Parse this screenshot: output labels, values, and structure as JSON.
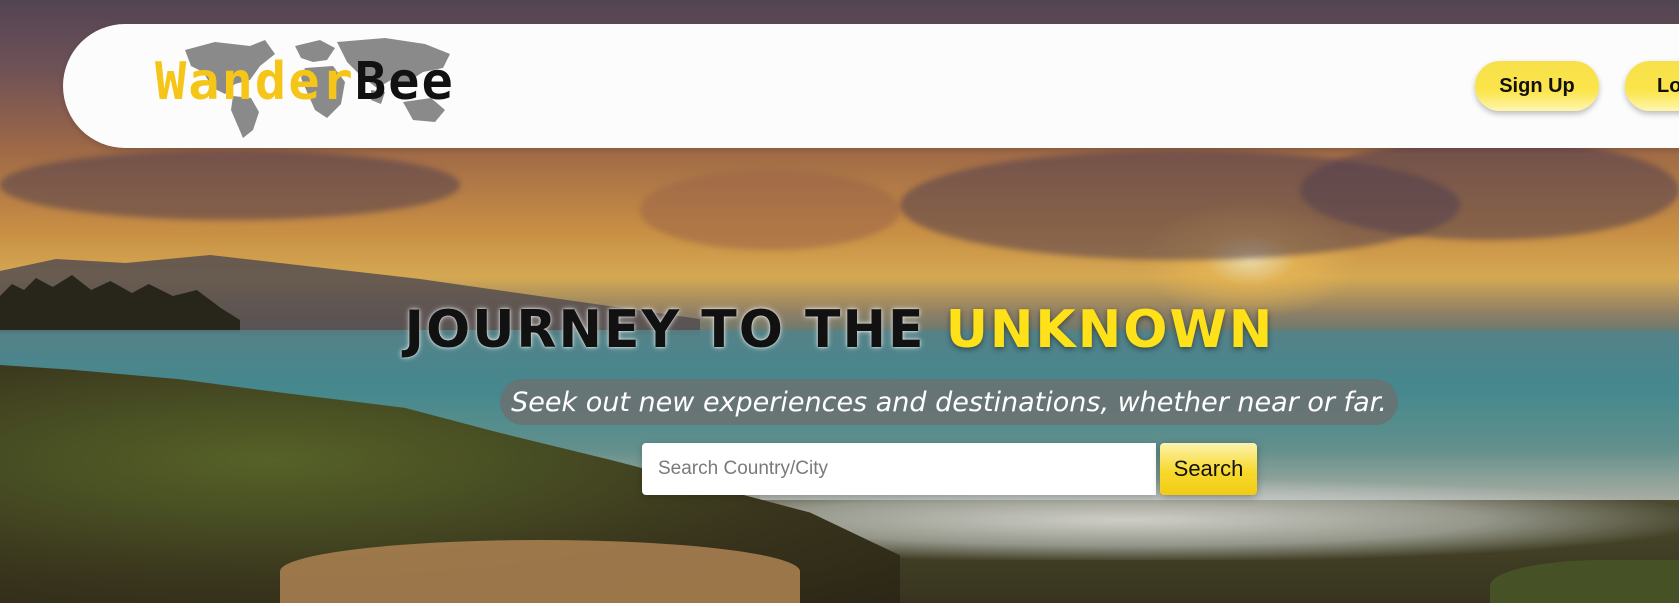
{
  "brand": {
    "name_part1": "Wander",
    "name_part2": "Bee"
  },
  "nav": {
    "signup_label": "Sign Up",
    "login_label": "Lo"
  },
  "hero": {
    "headline_main": "JOURNEY TO THE",
    "headline_accent": "UNKNOWN",
    "subtitle": "Seek out new experiences and destinations, whether near or far."
  },
  "search": {
    "placeholder": "Search Country/City",
    "value": "",
    "button_label": "Search"
  },
  "colors": {
    "accent_yellow": "#ffe11a",
    "navbar_bg": "#fcfcfc"
  },
  "icons": {
    "logo_background": "world-map-icon"
  }
}
